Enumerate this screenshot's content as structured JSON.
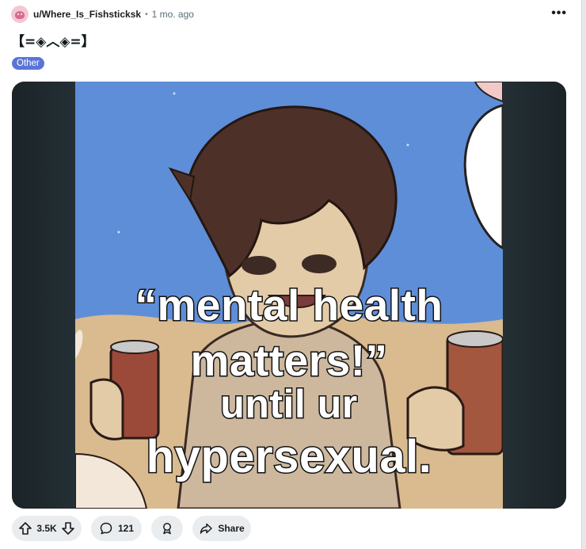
{
  "post": {
    "author": "u/Where_Is_Fishsticksk",
    "separator": "•",
    "time": "1 mo. ago",
    "more_menu": "•••",
    "title": "【=◈︿◈=】",
    "flair": "Other",
    "flair_color": "#5a75d6"
  },
  "image": {
    "caption_lines": [
      "“mental health",
      "matters!”",
      "until ur",
      "hypersexual."
    ]
  },
  "actions": {
    "vote_count": "3.5K",
    "comment_count": "121",
    "share_label": "Share",
    "icons": [
      "upvote-icon",
      "downvote-icon",
      "comment-icon",
      "award-icon",
      "share-icon"
    ]
  }
}
